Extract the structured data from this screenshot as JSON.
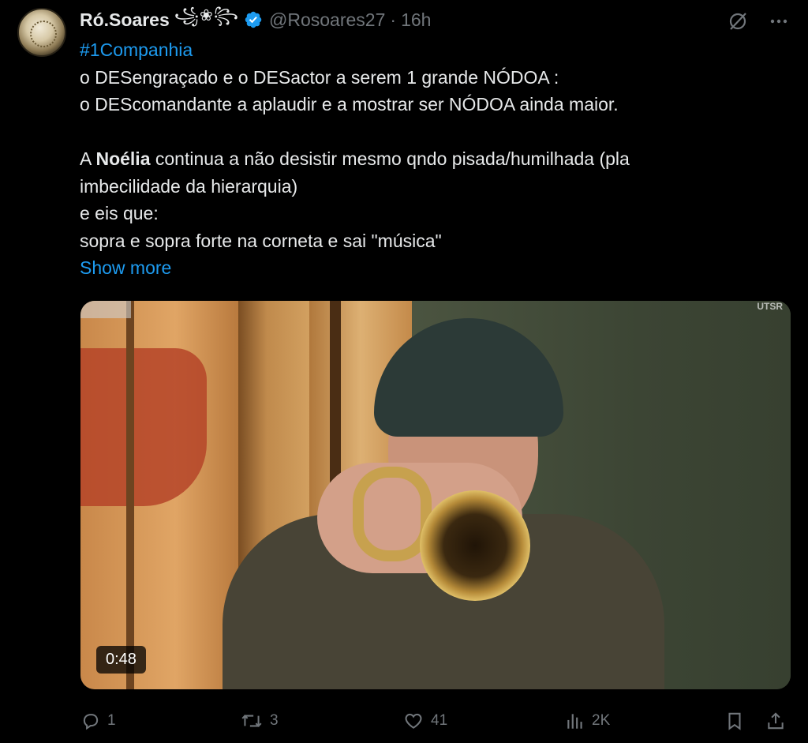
{
  "author": {
    "display_name": "Ró.Soares",
    "name_emoji": "꧁❀꧂",
    "handle": "@Rosoares27",
    "separator": "·",
    "time": "16h"
  },
  "tweet": {
    "lines": [
      {
        "hashtag": "#1Companhia"
      },
      {
        "text": "o DESengraçado e o DESactor a serem 1 grande NÓDOA :"
      },
      {
        "text": "o DEScomandante a aplaudir e a mostrar ser NÓDOA  ainda maior."
      },
      {
        "pre": "A ",
        "bold": "Noélia",
        "post": " continua a não desistir mesmo qndo pisada/humilhada (pla"
      },
      {
        "text": "imbecilidade da hierarquia)"
      },
      {
        "text": "e eis que:"
      },
      {
        "text": "sopra e sopra forte na corneta e sai \"música\""
      }
    ],
    "show_more": "Show more"
  },
  "media": {
    "duration": "0:48",
    "overlay_text": "UTSR"
  },
  "metrics": {
    "replies": "1",
    "reposts": "3",
    "likes": "41",
    "views": "2K"
  },
  "colors": {
    "accent": "#1d9bf0",
    "muted": "#71767b",
    "text": "#e7e9ea",
    "background": "#000000"
  },
  "icons": [
    "verified-badge-icon",
    "grok-icon",
    "more-icon",
    "reply-icon",
    "repost-icon",
    "like-icon",
    "views-icon",
    "bookmark-icon",
    "share-icon"
  ]
}
